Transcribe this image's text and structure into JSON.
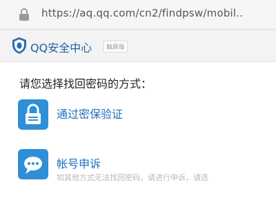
{
  "browser": {
    "url": "https://aq.qq.com/cn2/findpsw/mobil.."
  },
  "header": {
    "brand": "QQ安全中心",
    "badge": "触屏版"
  },
  "main": {
    "prompt": "请您选择找回密码的方式：",
    "options": [
      {
        "title": "通过密保验证",
        "icon": "lock-icon"
      },
      {
        "title": "帐号申诉",
        "description": "如其他方式无法找回密码，请进行申诉，请选",
        "icon": "chat-bubble-icon"
      }
    ]
  },
  "colors": {
    "accent": "#2e8fd8",
    "link": "#1f6fbf",
    "brand": "#1f5fa8"
  }
}
